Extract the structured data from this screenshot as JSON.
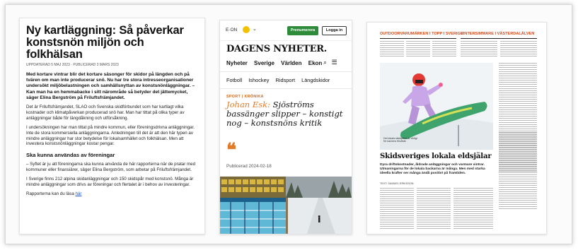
{
  "article": {
    "title": "Ny kartläggning: Så påverkar konstsnön miljön och folkhälsan",
    "meta": "UPPDATERAD 5 MAJ 2023 · PUBLICERAD 3 MARS 2023",
    "lead": "Med kortare vintrar blir det kortare säsonger för skidor på längden och på tvären om man inte producerar snö. Nu har tre stora intresseorganisationer undersökt miljöbelastningen och samhällsnyttan av konstsnönläggningar. – Kan man ha en hemmabacke i sitt närområde så betyder det jättemycket, säger Elina Bergström på Friluftsfrämjandet.",
    "p1": "Det är Friluftsfrämjandet, SLAO och Svenska skidförbundet som har kartlagt vilka kostnader och klimatpåverkan producerad snö har. Man har tittat på olika typer av anläggningar både för längdåkning och utförsåkning.",
    "p2": "I undersökningen har man tittat på mindre kommun, eller föreningsdrivna anläggningar. Inte de stora kommersiella anläggningarna. Anledningen till det är att den här typen av mindre anläggningar har stor betydelse för lokalsamhället och folkhälsan. Men att investera konstsnönläggningar kostar pengar.",
    "subhead": "Ska kunna användas av föreningar",
    "p3": "– Syftet är ju att föreningarna ska kunna använda de här rapporterna när de pratar med kommuner eller finansiärer, säger Elina Bergström, som arbetar på Friluftsfrämjandet.",
    "p4": "I Sverige finns 212 alpina skidanläggningar och 150 skidspår med konstsnö. Många är mindre anläggningar som drivs av föreningar och flertalet är i behov av investeringar.",
    "p5": "Rapporterna kan du läsa ",
    "link": "här"
  },
  "mobile": {
    "eon": "E·ON",
    "subscribe": "Prenumerera",
    "login": "Logga in",
    "logo": "DAGENS NYHETER.",
    "nav_primary": [
      "Nyheter",
      "Sverige",
      "Världen",
      "Ekon"
    ],
    "nav_secondary": [
      "Fotboll",
      "Ishockey",
      "Ridsport",
      "Längdskidor"
    ],
    "kicker": "SPORT | KRÖNIKA",
    "author": "Johan Esk:",
    "headline": " Sjöströms bassänger slipper – konstigt nog – konstsnöns kritik",
    "quote_mark": "❝",
    "published": "Publicerad 2024-02-18"
  },
  "newspaper": {
    "header_left": "OUTDOORVARUMÄRKEN I TOPP I SVERIGE",
    "header_right": "VINTERSIMMARE I VÄSTERDALÄLVEN",
    "caption": "Det lokala skidspåret är viktigt för barnens friluftsliv",
    "headline": "Skidsveriges lokala eldsjälar",
    "deck": "Dyra driftskostnader, åldrade anläggningar och varmare vintrar. Utmaningarna för de lokala backarna är många. Men med starka ideella krafter ser många ändå positivt på framtiden.",
    "byline": "TEXT: SAMUEL ERIKSSON"
  },
  "colors": {
    "accent_green": "#2e8b3a",
    "accent_orange": "#e07b29",
    "link_blue": "#1a56c8",
    "news_red": "#d04a1a"
  }
}
